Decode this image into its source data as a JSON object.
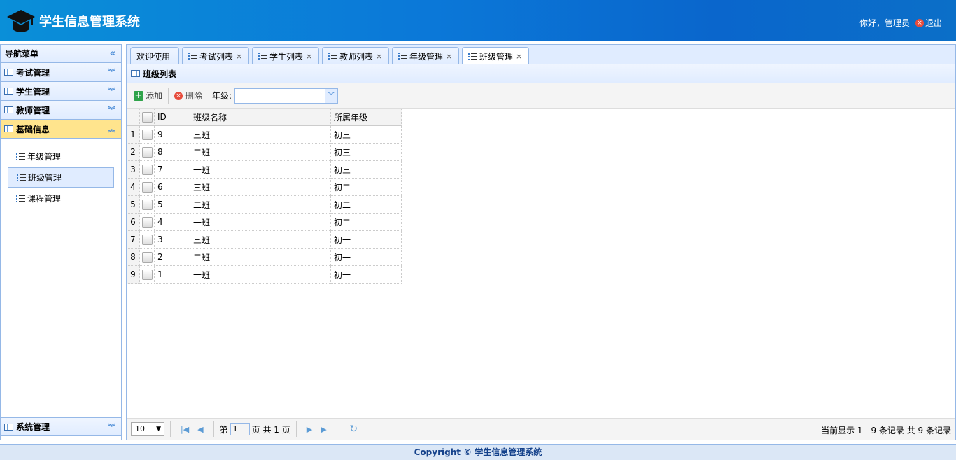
{
  "header": {
    "title": "学生信息管理系统",
    "greeting": "你好，管理员",
    "logout": "退出"
  },
  "sidebar": {
    "title": "导航菜单",
    "sections": [
      {
        "label": "考试管理",
        "active": false
      },
      {
        "label": "学生管理",
        "active": false
      },
      {
        "label": "教师管理",
        "active": false
      },
      {
        "label": "基础信息",
        "active": true
      }
    ],
    "subitems": [
      {
        "label": "年级管理",
        "selected": false
      },
      {
        "label": "班级管理",
        "selected": true
      },
      {
        "label": "课程管理",
        "selected": false
      }
    ],
    "bottom_section": "系统管理"
  },
  "tabs": [
    {
      "label": "欢迎使用",
      "closable": false
    },
    {
      "label": "考试列表",
      "closable": true
    },
    {
      "label": "学生列表",
      "closable": true
    },
    {
      "label": "教师列表",
      "closable": true
    },
    {
      "label": "年级管理",
      "closable": true
    },
    {
      "label": "班级管理",
      "closable": true,
      "active": true
    }
  ],
  "grid": {
    "title": "班级列表",
    "toolbar": {
      "add": "添加",
      "delete": "删除",
      "grade_label": "年级:",
      "grade_value": ""
    },
    "columns": [
      "ID",
      "班级名称",
      "所属年级"
    ],
    "rows": [
      {
        "num": "1",
        "id": "9",
        "name": "三班",
        "grade": "初三"
      },
      {
        "num": "2",
        "id": "8",
        "name": "二班",
        "grade": "初三"
      },
      {
        "num": "3",
        "id": "7",
        "name": "一班",
        "grade": "初三"
      },
      {
        "num": "4",
        "id": "6",
        "name": "三班",
        "grade": "初二"
      },
      {
        "num": "5",
        "id": "5",
        "name": "二班",
        "grade": "初二"
      },
      {
        "num": "6",
        "id": "4",
        "name": "一班",
        "grade": "初二"
      },
      {
        "num": "7",
        "id": "3",
        "name": "三班",
        "grade": "初一"
      },
      {
        "num": "8",
        "id": "2",
        "name": "二班",
        "grade": "初一"
      },
      {
        "num": "9",
        "id": "1",
        "name": "一班",
        "grade": "初一"
      }
    ]
  },
  "pager": {
    "page_size": "10",
    "page_prefix": "第",
    "page_value": "1",
    "page_suffix": "页 共 1 页",
    "info": "当前显示 1 - 9 条记录 共 9 条记录"
  },
  "footer": "Copyright © 学生信息管理系统"
}
